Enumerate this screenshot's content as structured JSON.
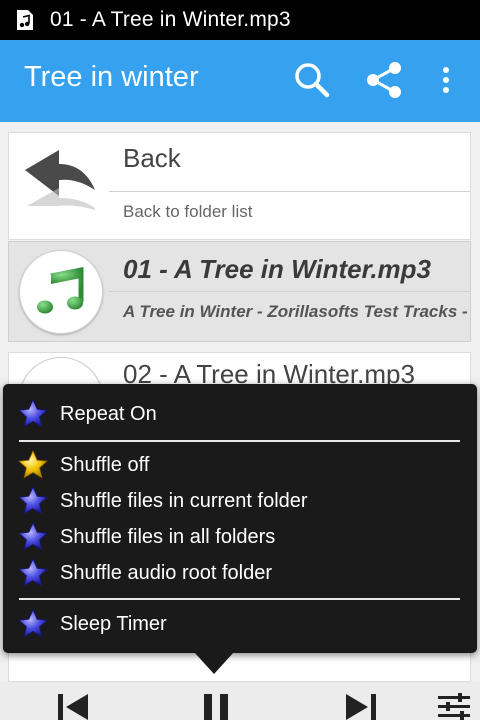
{
  "status_bar": {
    "title": "01 - A Tree in Winter.mp3",
    "icon": "music-file-icon"
  },
  "app_bar": {
    "title": "Tree in winter",
    "actions": [
      "search-icon",
      "share-icon",
      "overflow-menu-icon"
    ]
  },
  "list": [
    {
      "title": "Back",
      "subtitle": "Back to folder list",
      "icon": "back-arrow-icon"
    },
    {
      "title": "01 - A Tree in Winter.mp3",
      "subtitle": "A Tree in Winter - Zorillasofts Test Tracks -",
      "icon": "music-note-icon",
      "selected": true
    },
    {
      "title": "02 - A Tree in Winter.mp3"
    }
  ],
  "menu": {
    "items": [
      {
        "label": "Repeat On",
        "icon": "blue-star-icon"
      },
      {
        "label": "Shuffle off",
        "icon": "gold-star-icon"
      },
      {
        "label": "Shuffle files in current folder",
        "icon": "blue-star-icon"
      },
      {
        "label": "Shuffle files in all folders",
        "icon": "blue-star-icon"
      },
      {
        "label": "Shuffle audio root folder",
        "icon": "blue-star-icon"
      },
      {
        "label": "Sleep Timer",
        "icon": "blue-star-icon"
      }
    ]
  },
  "controls": [
    "previous-icon",
    "pause-icon",
    "next-icon",
    "equalizer-icon"
  ],
  "colors": {
    "app_bar": "#36a2ef",
    "popup": "#1a1a1a",
    "note_green": "#4caf50",
    "star_blue": "#3f3fd8",
    "star_gold": "#f2c200"
  }
}
